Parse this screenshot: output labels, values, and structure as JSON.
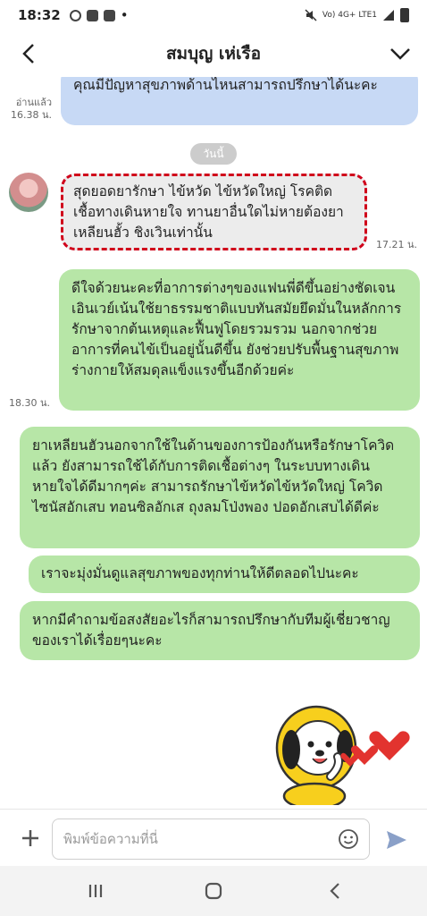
{
  "status_bar": {
    "time": "18:32",
    "network_label": "Vo) 4G+ LTE1",
    "dot": "•"
  },
  "header": {
    "title": "สมบุญ เห่เรือ",
    "back_icon": "chevron-left-icon",
    "menu_icon": "chevron-down-icon"
  },
  "chat": {
    "date_separator": "วันนี้",
    "messages": [
      {
        "side": "right",
        "color": "#c7d9f5",
        "text": "คุณมีปัญหาสุขภาพด้านไหนสามารถปรึกษาได้นะคะ",
        "read_label": "อ่านแล้ว",
        "time": "16.38 น."
      },
      {
        "side": "left",
        "color": "#ececec",
        "text": "สุดยอดยารักษา ไข้หวัด ไข้หวัดใหญ่ โรคติดเชื้อทางเดินหายใจ ทานยาอื่นใดไม่หายต้องยาเหลียนฮั้ว ชิงเวินเท่านั้น",
        "time": "17.21 น.",
        "highlighted": true
      },
      {
        "side": "right",
        "color": "#b7e6a7",
        "text": "ดีใจด้วยนะคะที่อาการต่างๆของแฟนพี่ดีขึ้นอย่างชัดเจน เอินเวย์เน้นใช้ยาธรรมชาติแบบทันสมัยยึดมั่นในหลักการรักษาจากต้นเหตุและฟื้นฟูโดยรวมรวม นอกจากช่วยอาการที่คนไข้เป็นอยู่นั้นดีขึ้น ยังช่วยปรับพื้นฐานสุขภาพร่างกายให้สมดุลแข็งแรงขึ้นอีกด้วยค่ะ",
        "time": "18.30 น."
      },
      {
        "side": "right",
        "color": "#b7e6a7",
        "text": "ยาเหลียนฮัวนอกจากใช้ในด้านของการป้องกันหรือรักษาโควิดแล้ว ยังสามารถใช้ได้กับการติดเชื้อต่างๆ ในระบบทางเดินหายใจได้ดีมากๆค่ะ สามารถรักษาไข้หวัดไข้หวัดใหญ่ โควิด ไซนัสอักเสบ ทอนซิลอักเส ถุงลมโป่งพอง ปอดอักเสบได้ดีค่ะ"
      },
      {
        "side": "right",
        "color": "#b7e6a7",
        "text": "เราจะมุ่งมั่นดูแลสุขภาพของทุกท่านให้ดีตลอดไปนะคะ"
      },
      {
        "side": "right",
        "color": "#b7e6a7",
        "text": "หากมีคำถามข้อสงสัยอะไรก็สามารถปรึกษากับทีมผู้เชี่ยวชาญของเราได้เรื่อยๆนะคะ"
      }
    ],
    "sticker": "cartoon-dog-with-hearts-sticker"
  },
  "input_bar": {
    "placeholder": "พิมพ์ข้อความที่นี่",
    "plus_icon": "plus-icon",
    "emoji_icon": "emoji-icon",
    "send_icon": "send-icon"
  },
  "nav_bar": {
    "recents_icon": "recents-icon",
    "home_icon": "home-icon",
    "back_icon": "back-icon"
  },
  "colors": {
    "own_bubble_green": "#b7e6a7",
    "own_bubble_blue": "#c7d9f5",
    "incoming_bubble": "#ececec",
    "highlight_border": "#d0021b",
    "send_icon": "#8aa0c8"
  }
}
